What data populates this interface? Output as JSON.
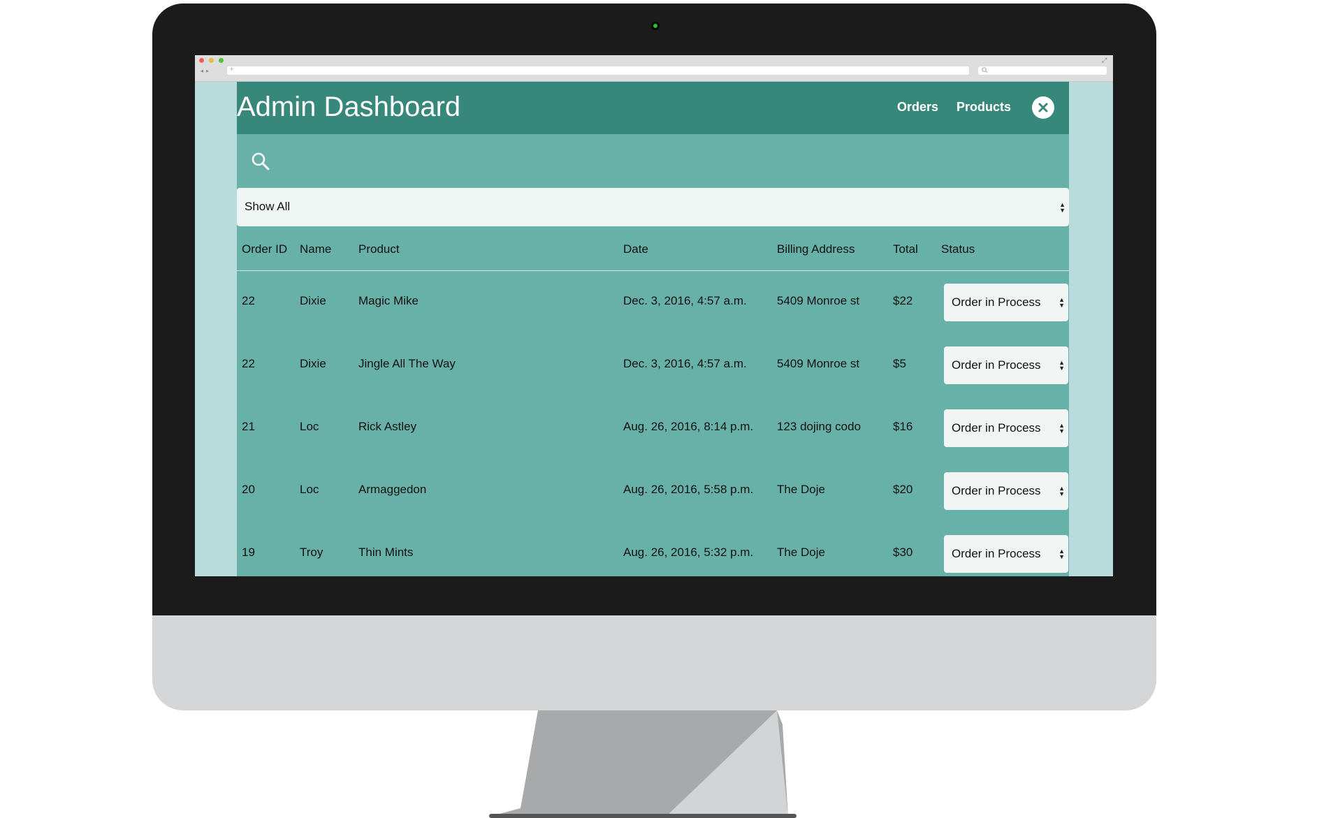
{
  "app": {
    "title": "Admin Dashboard",
    "nav": {
      "orders": "Orders",
      "products": "Products"
    }
  },
  "search": {
    "placeholder": ""
  },
  "filter": {
    "selected": "Show All"
  },
  "table": {
    "headers": [
      "Order ID",
      "Name",
      "Product",
      "Date",
      "Billing Address",
      "Total",
      "Status"
    ],
    "rows": [
      {
        "id": "22",
        "name": "Dixie",
        "product": "Magic Mike",
        "date": "Dec. 3, 2016, 4:57 a.m.",
        "address": "5409 Monroe st",
        "total": "$22",
        "status": "Order in Process"
      },
      {
        "id": "22",
        "name": "Dixie",
        "product": "Jingle All The Way",
        "date": "Dec. 3, 2016, 4:57 a.m.",
        "address": "5409 Monroe st",
        "total": "$5",
        "status": "Order in Process"
      },
      {
        "id": "21",
        "name": "Loc",
        "product": "Rick Astley",
        "date": "Aug. 26, 2016, 8:14 p.m.",
        "address": "123 dojing codo",
        "total": "$16",
        "status": "Order in Process"
      },
      {
        "id": "20",
        "name": "Loc",
        "product": "Armaggedon",
        "date": "Aug. 26, 2016, 5:58 p.m.",
        "address": "The Doje",
        "total": "$20",
        "status": "Order in Process"
      },
      {
        "id": "19",
        "name": "Troy",
        "product": "Thin Mints",
        "date": "Aug. 26, 2016, 5:32 p.m.",
        "address": "The Doje",
        "total": "$30",
        "status": "Order in Process"
      }
    ]
  },
  "colors": {
    "header_bg": "#37877a",
    "content_bg": "#67b1a9",
    "page_side_bg": "#b9dbdb",
    "select_bg": "#f0f6f4"
  },
  "icons": {
    "close": "close-icon",
    "search": "search-icon",
    "select_caret": "chevron-updown-icon"
  }
}
